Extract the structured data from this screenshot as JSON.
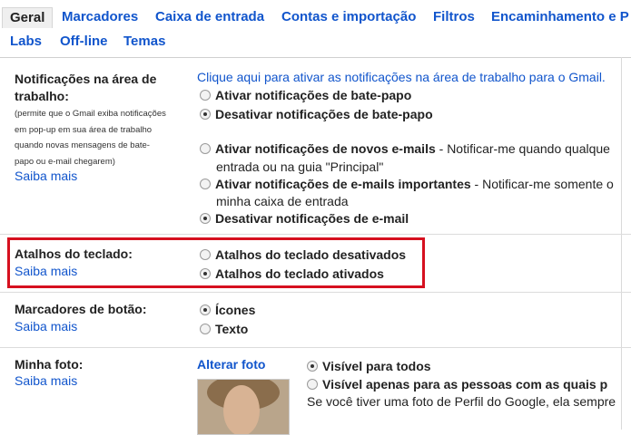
{
  "tabs": {
    "row1": [
      "Geral",
      "Marcadores",
      "Caixa de entrada",
      "Contas e importação",
      "Filtros",
      "Encaminhamento e P"
    ],
    "row2": [
      "Labs",
      "Off-line",
      "Temas"
    ]
  },
  "notifications": {
    "label": "Notificações na área de trabalho:",
    "help": [
      "(permite que o Gmail exiba notificações",
      "em pop-up em sua área de trabalho",
      "quando novas mensagens de bate-",
      "papo ou e-mail chegarem)"
    ],
    "learn_more": "Saiba mais",
    "enable_link": "Clique aqui para ativar as notificações na área de trabalho para o Gmail.",
    "chat_on": "Ativar notificações de bate-papo",
    "chat_off": "Desativar notificações de bate-papo",
    "new_mail": "Ativar notificações de novos e-mails",
    "new_mail_desc": " - Notificar-me quando qualque",
    "new_mail_desc2": "entrada ou na guia \"Principal\"",
    "important_mail": "Ativar notificações de e-mails importantes",
    "important_desc": " - Notificar-me somente o",
    "important_desc2": "minha caixa de entrada",
    "mail_off": "Desativar notificações de e-mail"
  },
  "shortcuts": {
    "label": "Atalhos do teclado:",
    "learn_more": "Saiba mais",
    "off": "Atalhos do teclado desativados",
    "on": "Atalhos do teclado ativados"
  },
  "button_labels": {
    "label": "Marcadores de botão:",
    "learn_more": "Saiba mais",
    "icons": "Ícones",
    "text": "Texto"
  },
  "my_photo": {
    "label": "Minha foto:",
    "learn_more": "Saiba mais",
    "change": "Alterar foto",
    "visible_all": "Visível para todos",
    "visible_some": "Visível apenas para as pessoas com as quais p",
    "note": "Se você tiver uma foto de Perfil do Google, ela sempre"
  },
  "colors": {
    "link": "#1155cc",
    "highlight": "#d6101f"
  }
}
